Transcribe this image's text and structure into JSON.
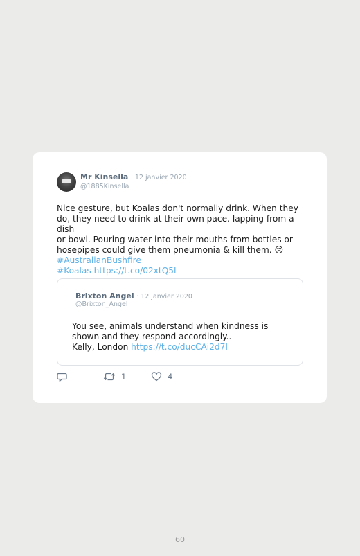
{
  "tweet": {
    "author_name": "Mr Kinsella",
    "date": "· 12 janvier 2020",
    "handle": "@1885Kinsella",
    "text_lines": [
      "Nice gesture, but Koalas don't normally drink. When they",
      "do, they need to drink at their own pace, lapping from a dish",
      "or bowl. Pouring water into their mouths from bottles or",
      "hosepipes could give them pneumonia & kill them. 😢"
    ],
    "hashtag": "#AustralianBushfire",
    "hashtag2": "#Koalas",
    "url": "https://t.co/02xtQ5L"
  },
  "quoted": {
    "author_name": "Brixton Angel",
    "date": "· 12 janvier 2020",
    "handle": "@Brixton_Angel",
    "text_lines": [
      "You see, animals understand when kindness is",
      "shown and they respond accordingly..",
      "Kelly, London"
    ],
    "url": "https://t.co/ducCAi2d7I"
  },
  "actions": {
    "reply_icon": "reply-icon",
    "retweet_icon": "retweet-icon",
    "retweet_count": "1",
    "like_icon": "heart-icon",
    "like_count": "4"
  },
  "page_number": "60"
}
